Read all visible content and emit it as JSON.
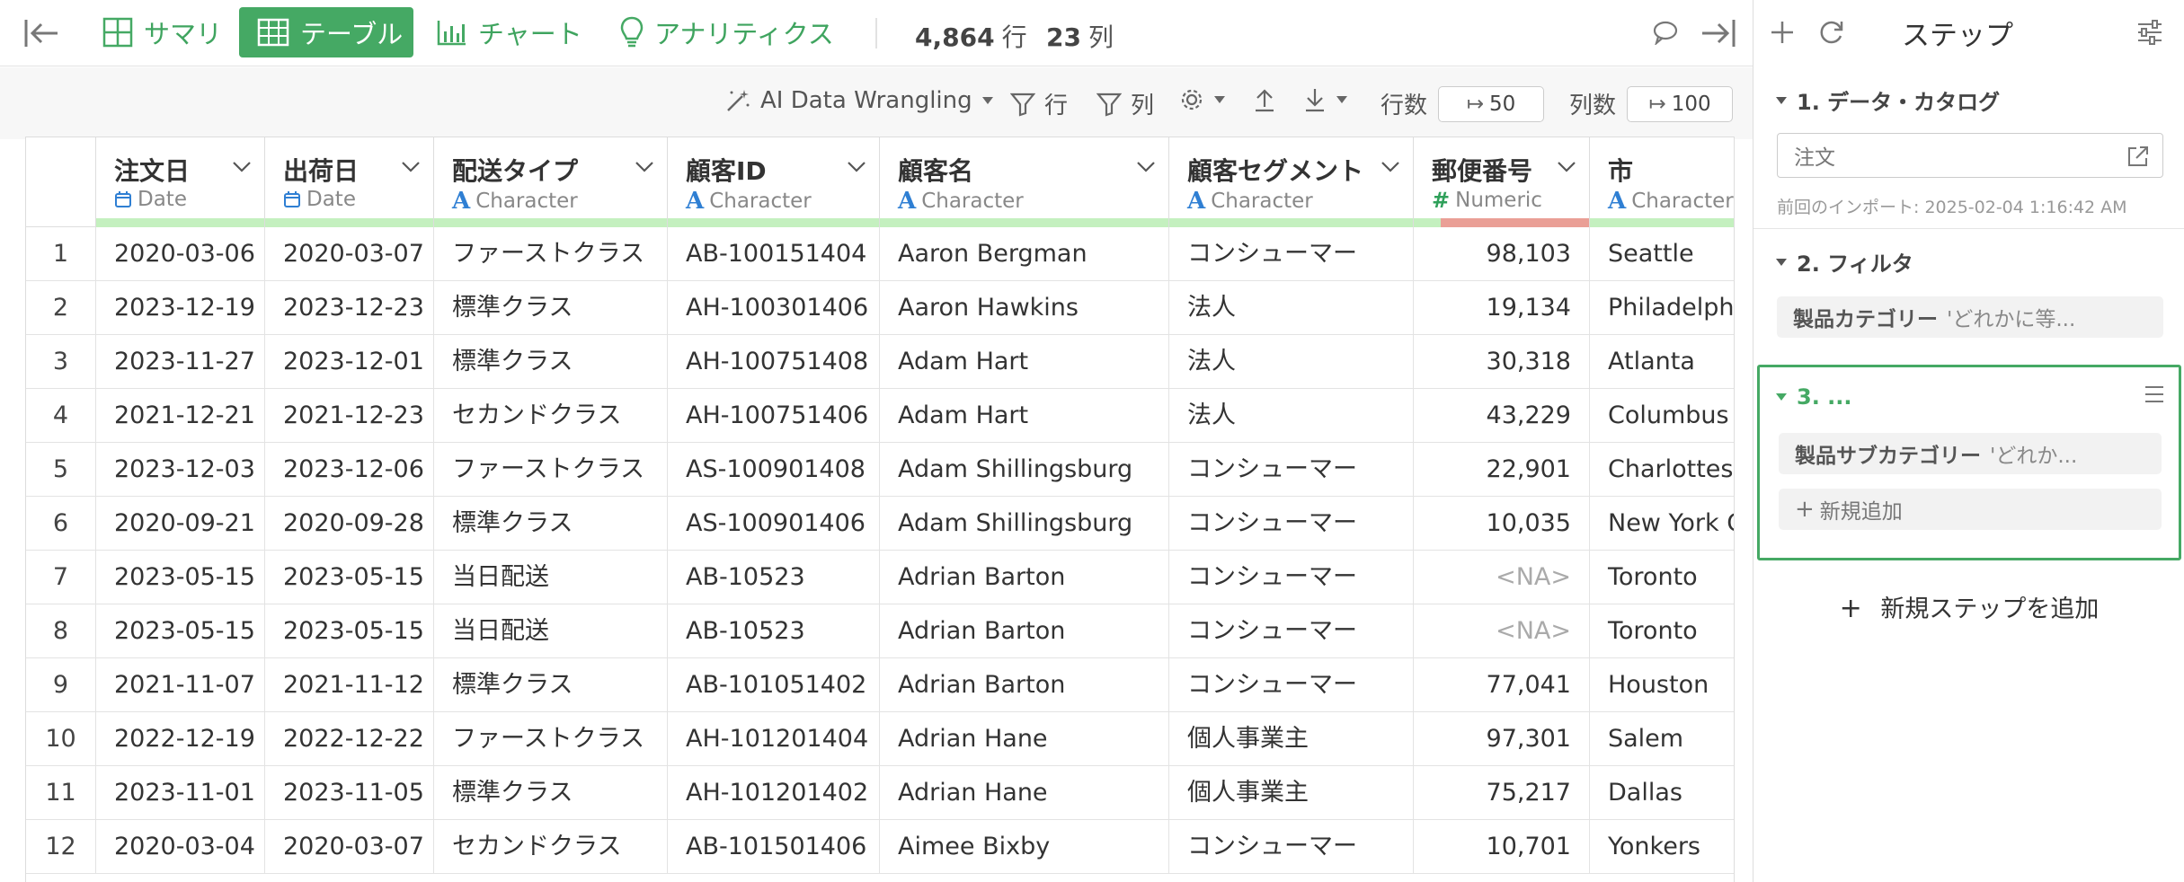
{
  "toolbar": {
    "tabs": [
      {
        "label": "サマリ",
        "icon": "summary-grid-icon"
      },
      {
        "label": "テーブル",
        "icon": "table-icon",
        "active": true
      },
      {
        "label": "チャート",
        "icon": "bar-chart-icon"
      },
      {
        "label": "アナリティクス",
        "icon": "lightbulb-icon"
      }
    ],
    "rows_count": "4,864",
    "rows_unit": "行",
    "cols_count": "23",
    "cols_unit": "列"
  },
  "subtoolbar": {
    "ai_label": "AI Data Wrangling",
    "row_filter_label": "行",
    "col_filter_label": "列",
    "rows_label": "行数",
    "rows_value": "50",
    "cols_label": "列数",
    "cols_value": "100"
  },
  "table": {
    "columns": [
      {
        "name": "注文日",
        "type": "Date"
      },
      {
        "name": "出荷日",
        "type": "Date"
      },
      {
        "name": "配送タイプ",
        "type": "Character"
      },
      {
        "name": "顧客ID",
        "type": "Character"
      },
      {
        "name": "顧客名",
        "type": "Character"
      },
      {
        "name": "顧客セグメント",
        "type": "Character"
      },
      {
        "name": "郵便番号",
        "type": "Numeric"
      },
      {
        "name": "市",
        "type": "Character"
      }
    ],
    "rows": [
      [
        "1",
        "2020-03-06",
        "2020-03-07",
        "ファーストクラス",
        "AB-100151404",
        "Aaron Bergman",
        "コンシューマー",
        "98,103",
        "Seattle"
      ],
      [
        "2",
        "2023-12-19",
        "2023-12-23",
        "標準クラス",
        "AH-100301406",
        "Aaron Hawkins",
        "法人",
        "19,134",
        "Philadelphia"
      ],
      [
        "3",
        "2023-11-27",
        "2023-12-01",
        "標準クラス",
        "AH-100751408",
        "Adam Hart",
        "法人",
        "30,318",
        "Atlanta"
      ],
      [
        "4",
        "2021-12-21",
        "2021-12-23",
        "セカンドクラス",
        "AH-100751406",
        "Adam Hart",
        "法人",
        "43,229",
        "Columbus"
      ],
      [
        "5",
        "2023-12-03",
        "2023-12-06",
        "ファーストクラス",
        "AS-100901408",
        "Adam Shillingsburg",
        "コンシューマー",
        "22,901",
        "Charlottesville"
      ],
      [
        "6",
        "2020-09-21",
        "2020-09-28",
        "標準クラス",
        "AS-100901406",
        "Adam Shillingsburg",
        "コンシューマー",
        "10,035",
        "New York City"
      ],
      [
        "7",
        "2023-05-15",
        "2023-05-15",
        "当日配送",
        "AB-10523",
        "Adrian Barton",
        "コンシューマー",
        "<NA>",
        "Toronto"
      ],
      [
        "8",
        "2023-05-15",
        "2023-05-15",
        "当日配送",
        "AB-10523",
        "Adrian Barton",
        "コンシューマー",
        "<NA>",
        "Toronto"
      ],
      [
        "9",
        "2021-11-07",
        "2021-11-12",
        "標準クラス",
        "AB-101051402",
        "Adrian Barton",
        "コンシューマー",
        "77,041",
        "Houston"
      ],
      [
        "10",
        "2022-12-19",
        "2022-12-22",
        "ファーストクラス",
        "AH-101201404",
        "Adrian Hane",
        "個人事業主",
        "97,301",
        "Salem"
      ],
      [
        "11",
        "2023-11-01",
        "2023-11-05",
        "標準クラス",
        "AH-101201402",
        "Adrian Hane",
        "個人事業主",
        "75,217",
        "Dallas"
      ],
      [
        "12",
        "2020-03-04",
        "2020-03-07",
        "セカンドクラス",
        "AB-101501406",
        "Aimee Bixby",
        "コンシューマー",
        "10,701",
        "Yonkers"
      ]
    ]
  },
  "panel": {
    "title": "ステップ",
    "steps": [
      {
        "title": "1. データ・カタログ",
        "source": "注文",
        "import_text": "前回のインポート: 2025-02-04 1:16:42 AM"
      },
      {
        "title": "2. フィルタ",
        "chip_field": "製品カテゴリー",
        "chip_cond": "'どれかに等..."
      },
      {
        "title": "3. ...",
        "chip_field": "製品サブカテゴリー",
        "chip_cond": "'どれか...",
        "add_label": "新規追加"
      }
    ],
    "add_step_label": "新規ステップを追加"
  },
  "colors": {
    "accent_green": "#45a964",
    "numeric_na_bar": "#ea9f96",
    "valid_bar": "#c4f0bf"
  }
}
